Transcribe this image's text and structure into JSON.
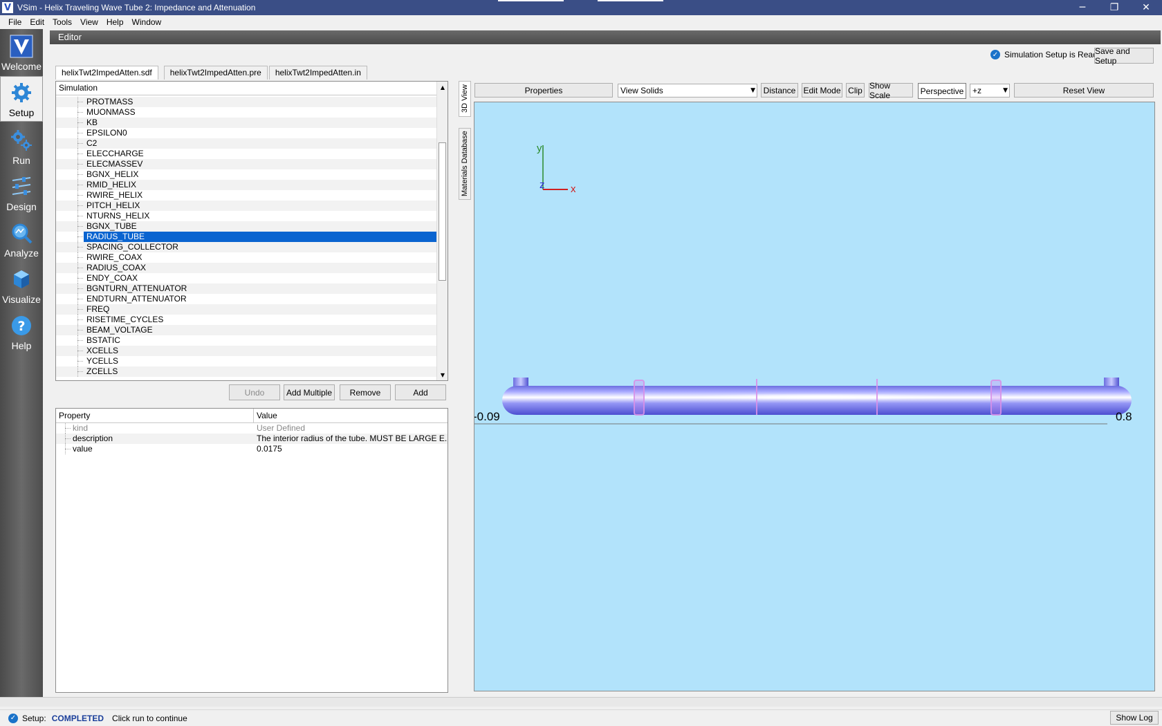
{
  "window": {
    "title": "VSim - Helix Traveling Wave Tube 2: Impedance and Attenuation",
    "minimize": "─",
    "restore": "❐",
    "close": "✕"
  },
  "menu": [
    "File",
    "Edit",
    "Tools",
    "View",
    "Help",
    "Window"
  ],
  "nav": [
    {
      "label": "Welcome",
      "icon": "vsim-logo-icon"
    },
    {
      "label": "Setup",
      "icon": "gear-icon"
    },
    {
      "label": "Run",
      "icon": "gears-icon"
    },
    {
      "label": "Design",
      "icon": "sliders-icon"
    },
    {
      "label": "Analyze",
      "icon": "magnifier-icon"
    },
    {
      "label": "Visualize",
      "icon": "cube-icon"
    },
    {
      "label": "Help",
      "icon": "question-icon"
    }
  ],
  "editor": {
    "header": "Editor",
    "status_text": "Simulation Setup is Ready",
    "save_setup": "Save and Setup",
    "tabs": [
      "helixTwt2ImpedAtten.sdf",
      "helixTwt2ImpedAtten.pre",
      "helixTwt2ImpedAtten.in"
    ]
  },
  "tree": {
    "header": "Simulation",
    "items": [
      "PROTMASS",
      "MUONMASS",
      "KB",
      "EPSILON0",
      "C2",
      "ELECCHARGE",
      "ELECMASSEV",
      "BGNX_HELIX",
      "RMID_HELIX",
      "RWIRE_HELIX",
      "PITCH_HELIX",
      "NTURNS_HELIX",
      "BGNX_TUBE",
      "RADIUS_TUBE",
      "SPACING_COLLECTOR",
      "RWIRE_COAX",
      "RADIUS_COAX",
      "ENDY_COAX",
      "BGNTURN_ATTENUATOR",
      "ENDTURN_ATTENUATOR",
      "FREQ",
      "RISETIME_CYCLES",
      "BEAM_VOLTAGE",
      "BSTATIC",
      "XCELLS",
      "YCELLS",
      "ZCELLS"
    ],
    "selected": "RADIUS_TUBE"
  },
  "tree_buttons": {
    "undo": "Undo",
    "add_multiple": "Add Multiple",
    "remove": "Remove",
    "add": "Add"
  },
  "properties": {
    "col_property": "Property",
    "col_value": "Value",
    "rows": [
      {
        "property": "kind",
        "value": "User Defined"
      },
      {
        "property": "description",
        "value": "The interior radius of the tube.  MUST BE LARGE E..."
      },
      {
        "property": "value",
        "value": "0.0175"
      }
    ]
  },
  "side_tabs": {
    "view3d": "3D View",
    "materials": "Materials Database"
  },
  "view_toolbar": {
    "properties": "Properties",
    "view_mode": "View Solids",
    "distance": "Distance",
    "edit_mode": "Edit Mode",
    "clip": "Clip",
    "show_scale": "Show Scale",
    "perspective": "Perspective",
    "axis": "+z",
    "reset_view": "Reset View"
  },
  "viewport": {
    "axis_y": "y",
    "axis_z": "z",
    "axis_x": "x",
    "x_min_label": "-0.09",
    "x_max_label": "0.8",
    "bg_color": "#b2e3fb",
    "tube_color": "#8a8cf0"
  },
  "status": {
    "prefix": "Setup:",
    "state": "COMPLETED",
    "message": "Click run to continue",
    "show_log": "Show Log"
  }
}
